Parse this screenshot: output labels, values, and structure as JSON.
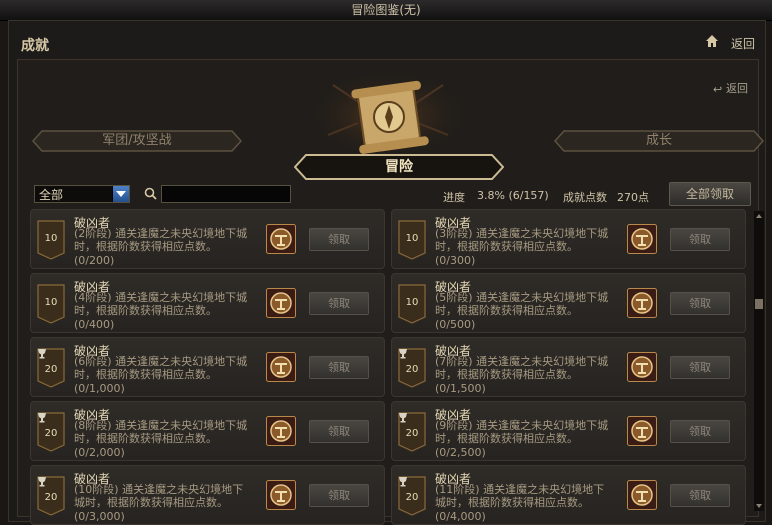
{
  "window": {
    "title": "冒险图鉴(无)"
  },
  "header": {
    "title": "成就",
    "return_label": "返回"
  },
  "inner": {
    "return_label": "返回"
  },
  "tabs": [
    {
      "label": "军团/攻坚战",
      "active": false
    },
    {
      "label": "冒险",
      "active": true
    },
    {
      "label": "成长",
      "active": false
    }
  ],
  "filter": {
    "selected": "全部"
  },
  "search": {
    "value": "",
    "placeholder": ""
  },
  "progress": {
    "label": "进度",
    "value": "3.8% (6/157)"
  },
  "points": {
    "label": "成就点数",
    "value": "270点"
  },
  "claim_all_label": "全部领取",
  "achievements": [
    {
      "badge": "10",
      "type": "plain",
      "title": "破凶者",
      "desc": "(2阶段) 通关逢魔之未央幻境地下城时，根据阶数获得相应点数。",
      "progress": "(0/200)",
      "button": "领取"
    },
    {
      "badge": "10",
      "type": "plain",
      "title": "破凶者",
      "desc": "(3阶段) 通关逢魔之未央幻境地下城时，根据阶数获得相应点数。",
      "progress": "(0/300)",
      "button": "领取"
    },
    {
      "badge": "10",
      "type": "plain",
      "title": "破凶者",
      "desc": "(4阶段) 通关逢魔之未央幻境地下城时，根据阶数获得相应点数。",
      "progress": "(0/400)",
      "button": "领取"
    },
    {
      "badge": "10",
      "type": "plain",
      "title": "破凶者",
      "desc": "(5阶段) 通关逢魔之未央幻境地下城时，根据阶数获得相应点数。",
      "progress": "(0/500)",
      "button": "领取"
    },
    {
      "badge": "20",
      "type": "trophy",
      "title": "破凶者",
      "desc": "(6阶段) 通关逢魔之未央幻境地下城时，根据阶数获得相应点数。",
      "progress": "(0/1,000)",
      "button": "领取"
    },
    {
      "badge": "20",
      "type": "trophy",
      "title": "破凶者",
      "desc": "(7阶段) 通关逢魔之未央幻境地下城时，根据阶数获得相应点数。",
      "progress": "(0/1,500)",
      "button": "领取"
    },
    {
      "badge": "20",
      "type": "trophy",
      "title": "破凶者",
      "desc": "(8阶段) 通关逢魔之未央幻境地下城时，根据阶数获得相应点数。",
      "progress": "(0/2,000)",
      "button": "领取"
    },
    {
      "badge": "20",
      "type": "trophy",
      "title": "破凶者",
      "desc": "(9阶段) 通关逢魔之未央幻境地下城时，根据阶数获得相应点数。",
      "progress": "(0/2,500)",
      "button": "领取"
    },
    {
      "badge": "20",
      "type": "trophy",
      "title": "破凶者",
      "desc": "(10阶段) 通关逢魔之未央幻境地下城时，根据阶数获得相应点数。",
      "progress": "(0/3,000)",
      "button": "领取"
    },
    {
      "badge": "20",
      "type": "trophy",
      "title": "破凶者",
      "desc": "(11阶段) 通关逢魔之未央幻境地下城时，根据阶数获得相应点数。",
      "progress": "(0/4,000)",
      "button": "领取"
    }
  ],
  "scrollbar": {
    "position": 0.3
  },
  "colors": {
    "accent": "#f3e5c0",
    "badge_fill": "#3a2d1c",
    "badge_border": "#8a6a3a"
  }
}
